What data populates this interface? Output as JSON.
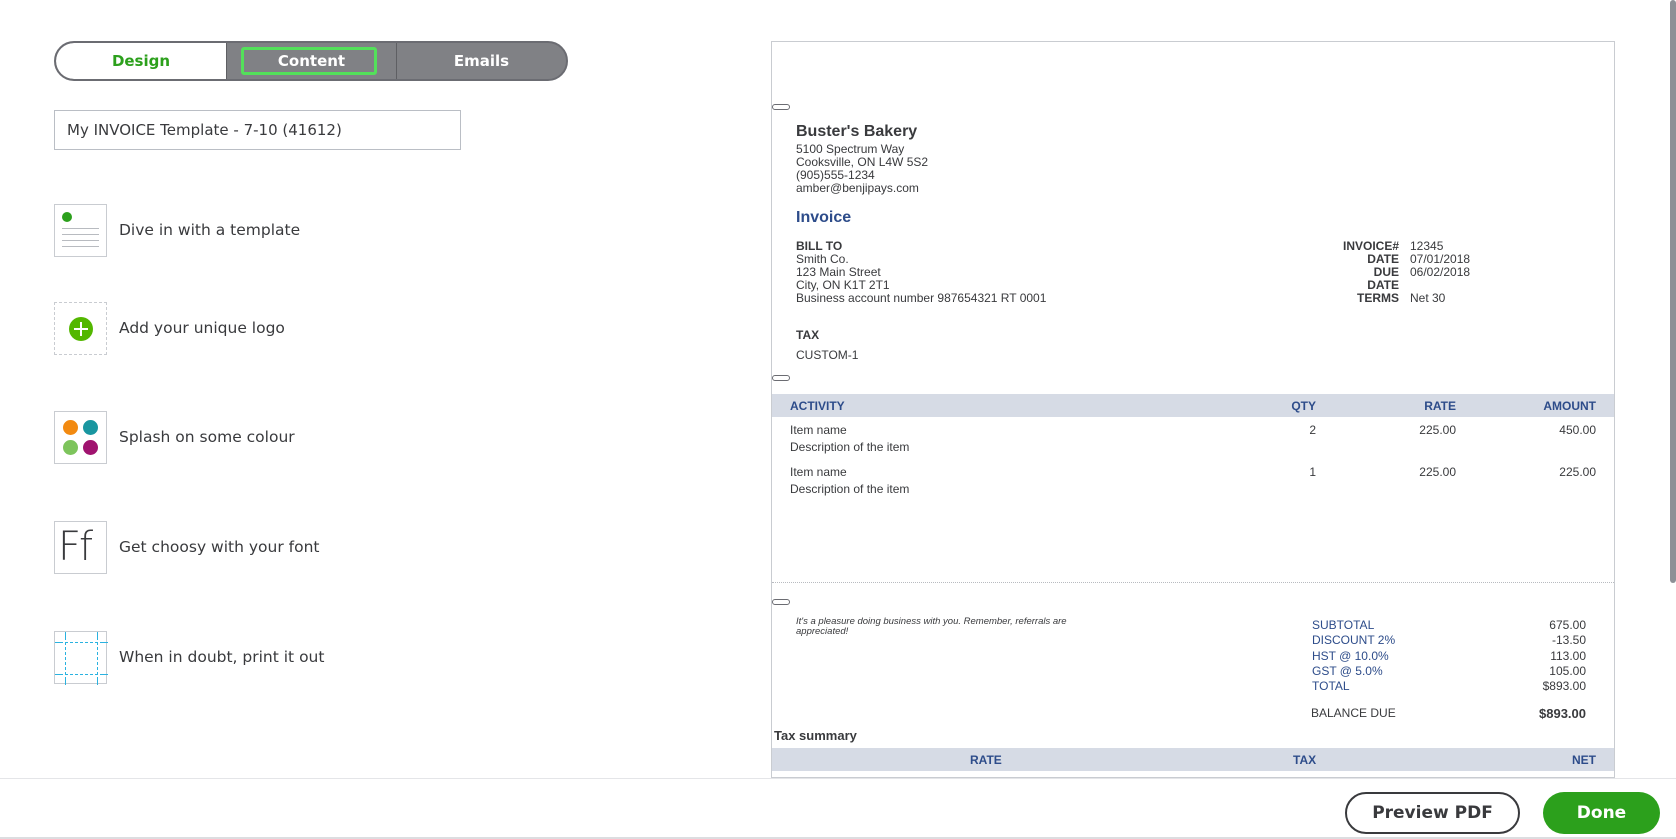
{
  "tabs": {
    "design": "Design",
    "content": "Content",
    "emails": "Emails"
  },
  "template_name": "My INVOICE Template - 7-10 (41612)",
  "options": [
    {
      "label": "Dive in with a template"
    },
    {
      "label": "Add your unique logo"
    },
    {
      "label": "Splash on some colour"
    },
    {
      "label": "Get choosy with your font"
    },
    {
      "label": "When in doubt, print it out"
    }
  ],
  "icons": {
    "font_glyph": "Ff"
  },
  "colors": {
    "accent_green": "#2ca01c",
    "swatch_orange": "#f28a11",
    "swatch_teal": "#1996a0",
    "swatch_lightgreen": "#7dc45c",
    "swatch_magenta": "#a0136f",
    "table_header": "#d6dbe5",
    "label_blue": "#2d4c8a"
  },
  "invoice": {
    "company": {
      "name": "Buster's Bakery",
      "address1": "5100 Spectrum Way",
      "address2": "Cooksville, ON L4W 5S2",
      "phone": "(905)555-1234",
      "email": "amber@benjipays.com"
    },
    "title": "Invoice",
    "bill_to": {
      "heading": "BILL TO",
      "name": "Smith Co.",
      "street": "123 Main Street",
      "city": "City, ON K1T 2T1",
      "business_account": "Business account number  987654321 RT 0001"
    },
    "meta": [
      {
        "key": "INVOICE#",
        "value": "12345"
      },
      {
        "key": "DATE",
        "value": "07/01/2018"
      },
      {
        "key": "DUE DATE",
        "value": "06/02/2018"
      },
      {
        "key": "TERMS",
        "value": "Net 30"
      }
    ],
    "tax": {
      "heading": "TAX",
      "value": "CUSTOM-1"
    },
    "columns": {
      "activity": "ACTIVITY",
      "qty": "QTY",
      "rate": "RATE",
      "amount": "AMOUNT"
    },
    "lines": [
      {
        "name": "Item name",
        "desc": "Description of the item",
        "qty": "2",
        "rate": "225.00",
        "amount": "450.00"
      },
      {
        "name": "Item name",
        "desc": "Description of the item",
        "qty": "1",
        "rate": "225.00",
        "amount": "225.00"
      }
    ],
    "note": "It's a pleasure doing business with you. Remember, referrals are appreciated!",
    "totals": [
      {
        "key": "SUBTOTAL",
        "value": "675.00"
      },
      {
        "key": "DISCOUNT 2%",
        "value": "-13.50"
      },
      {
        "key": "HST @ 10.0%",
        "value": "113.00"
      },
      {
        "key": "GST @ 5.0%",
        "value": "105.00"
      },
      {
        "key": "TOTAL",
        "value": "$893.00"
      }
    ],
    "balance_due": {
      "key": "BALANCE DUE",
      "value": "$893.00"
    },
    "tax_summary": {
      "heading": "Tax summary",
      "rate": "RATE",
      "tax": "TAX",
      "net": "NET"
    }
  },
  "footer": {
    "preview_pdf": "Preview PDF",
    "done": "Done"
  }
}
